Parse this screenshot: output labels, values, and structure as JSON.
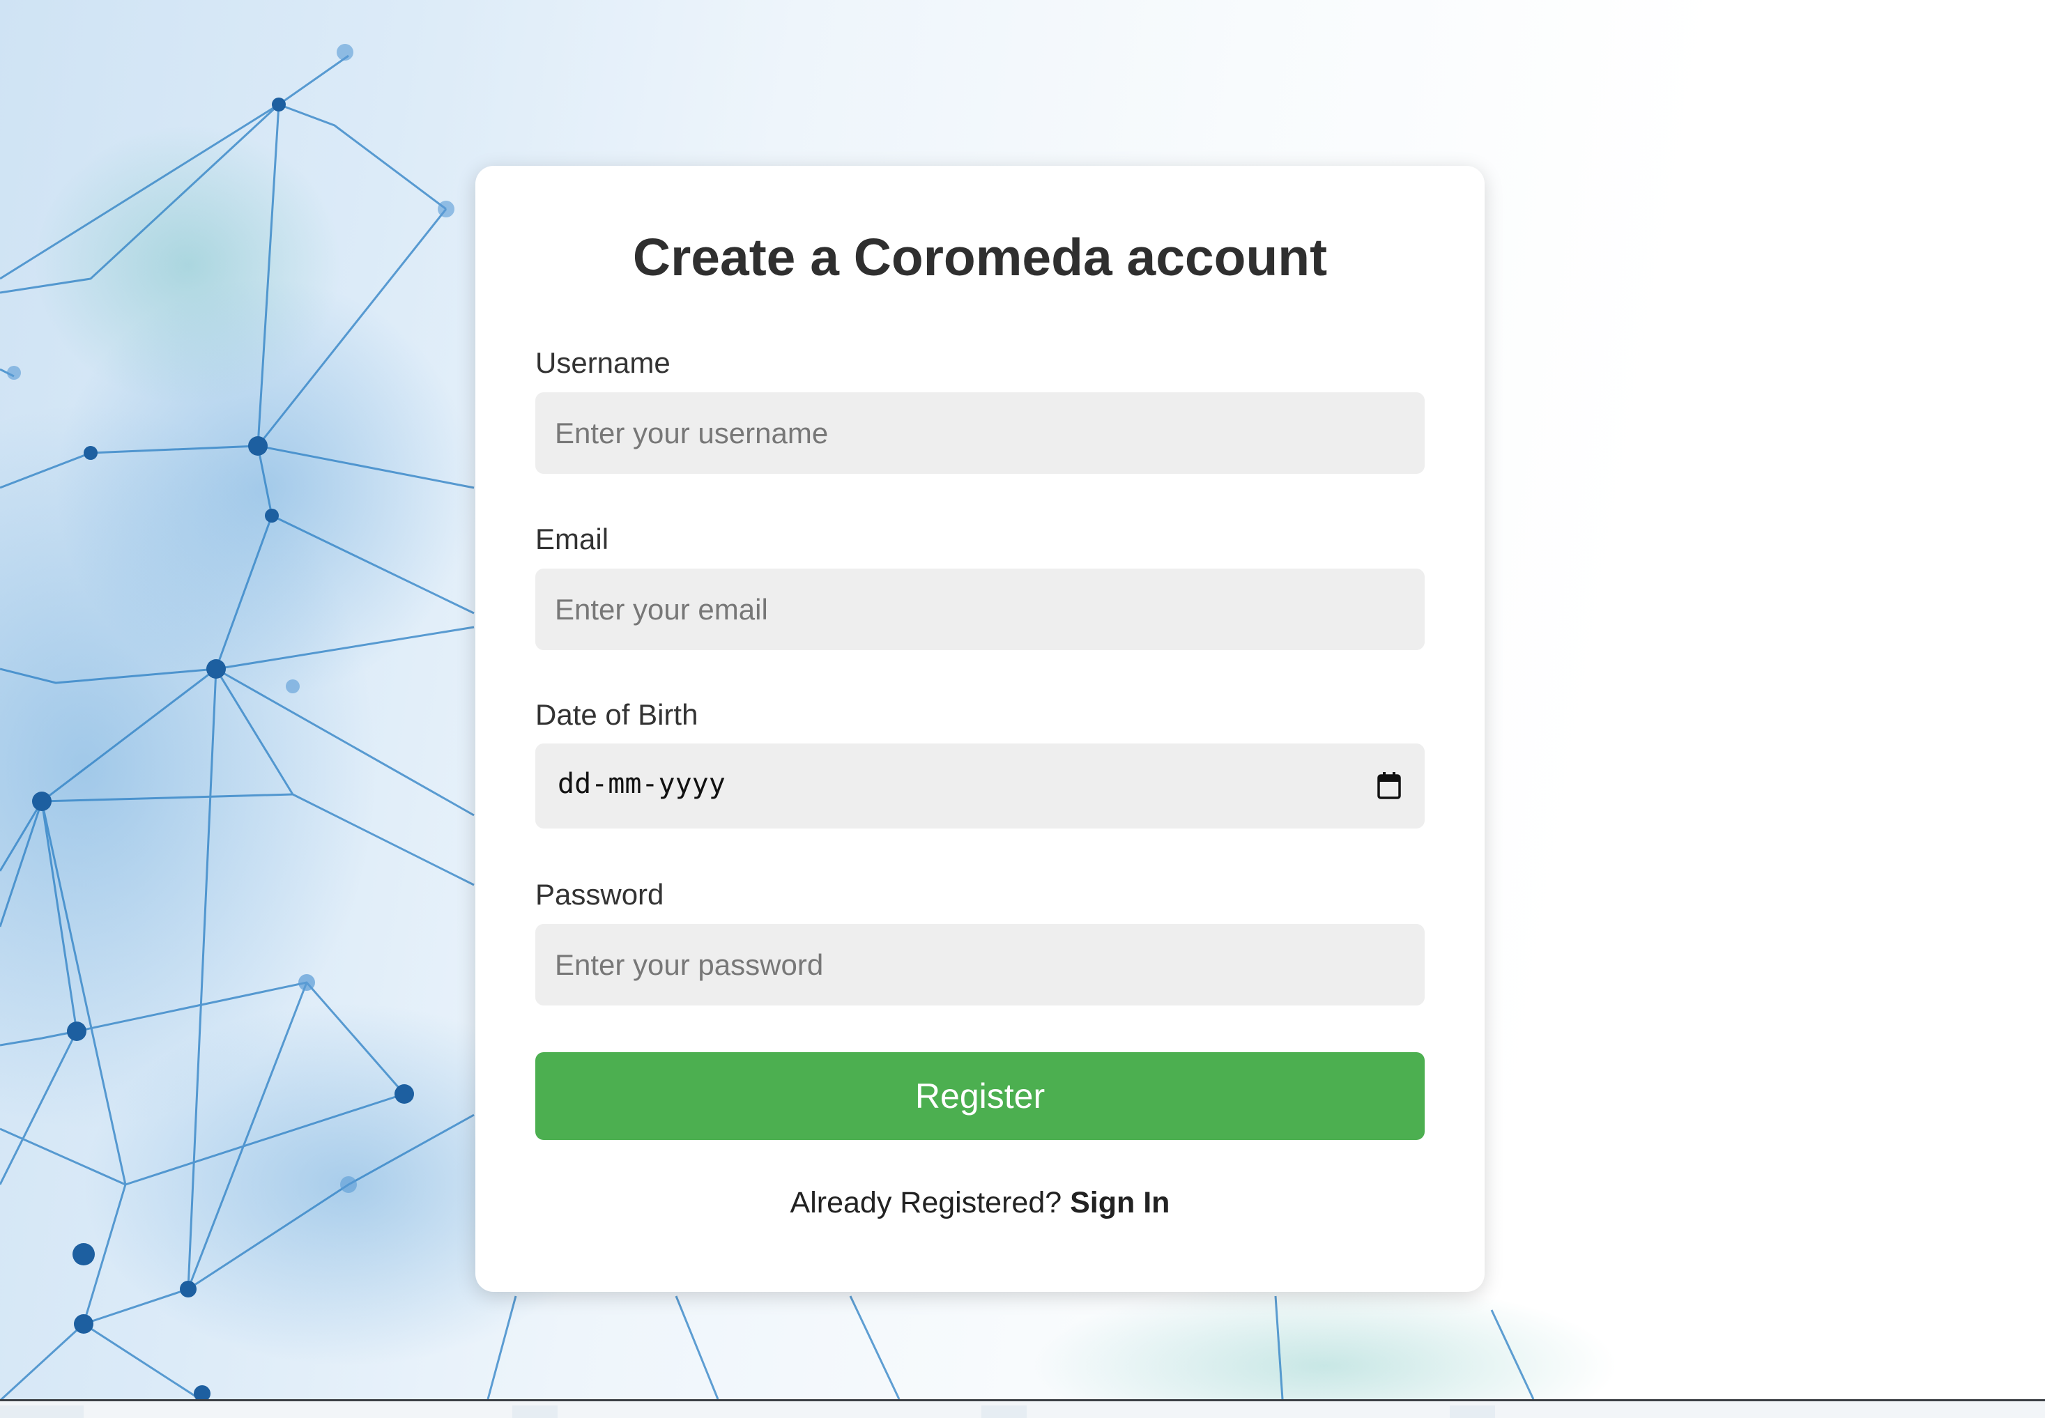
{
  "form": {
    "title": "Create a Coromeda account",
    "username": {
      "label": "Username",
      "placeholder": "Enter your username"
    },
    "email": {
      "label": "Email",
      "placeholder": "Enter your email"
    },
    "dob": {
      "label": "Date of Birth",
      "placeholder": "dd-mm-yyyy",
      "icon": "calendar-icon"
    },
    "password": {
      "label": "Password",
      "placeholder": "Enter your password"
    },
    "register_label": "Register",
    "already_registered": "Already Registered?",
    "sign_in_label": "Sign In"
  },
  "colors": {
    "register_button": "#4caf50",
    "input_background": "#eeeeee",
    "title_text": "#2f2f2f",
    "background_network": "#1f78c8"
  }
}
